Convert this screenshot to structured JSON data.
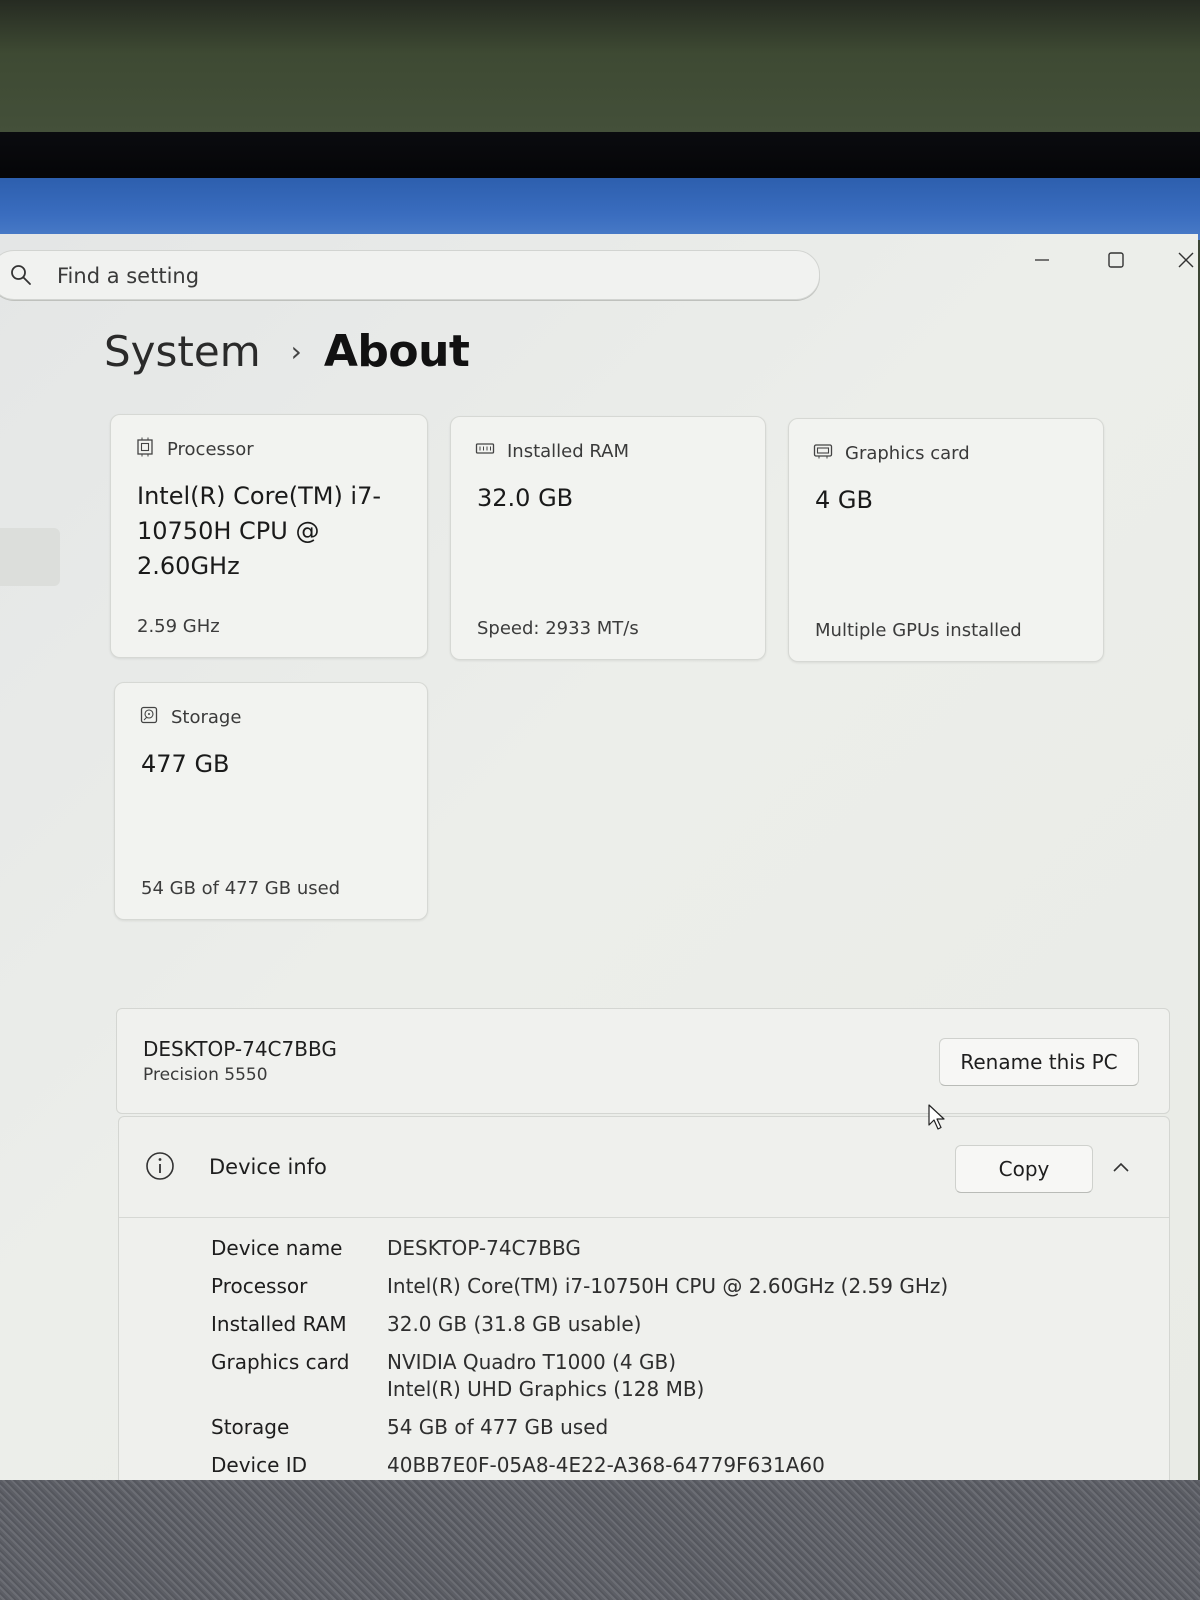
{
  "search": {
    "placeholder": "Find a setting"
  },
  "breadcrumb": {
    "parent": "System",
    "separator": "›",
    "current": "About"
  },
  "cards": [
    {
      "icon": "processor-icon",
      "title": "Processor",
      "value": "Intel(R) Core(TM) i7-10750H CPU @ 2.60GHz",
      "sub": "2.59 GHz"
    },
    {
      "icon": "ram-icon",
      "title": "Installed RAM",
      "value": "32.0 GB",
      "sub": "Speed: 2933 MT/s"
    },
    {
      "icon": "graphics-card-icon",
      "title": "Graphics card",
      "value": "4 GB",
      "sub": "Multiple GPUs installed"
    },
    {
      "icon": "storage-icon",
      "title": "Storage",
      "value": "477 GB",
      "sub": "54 GB of 477 GB used"
    }
  ],
  "pc": {
    "name": "DESKTOP-74C7BBG",
    "model": "Precision 5550",
    "rename_label": "Rename this PC"
  },
  "device_info": {
    "title": "Device info",
    "copy_label": "Copy",
    "specs": [
      {
        "label": "Device name",
        "value": "DESKTOP-74C7BBG"
      },
      {
        "label": "Processor",
        "value": "Intel(R) Core(TM) i7-10750H CPU @ 2.60GHz (2.59 GHz)"
      },
      {
        "label": "Installed RAM",
        "value": "32.0 GB (31.8 GB usable)"
      },
      {
        "label": "Graphics card",
        "value": "NVIDIA Quadro T1000 (4 GB)",
        "value2": "Intel(R) UHD Graphics (128 MB)"
      },
      {
        "label": "Storage",
        "value": "54 GB of 477 GB used"
      },
      {
        "label": "Device ID",
        "value": "40BB7E0F-05A8-4E22-A368-64779F631A60"
      }
    ]
  }
}
